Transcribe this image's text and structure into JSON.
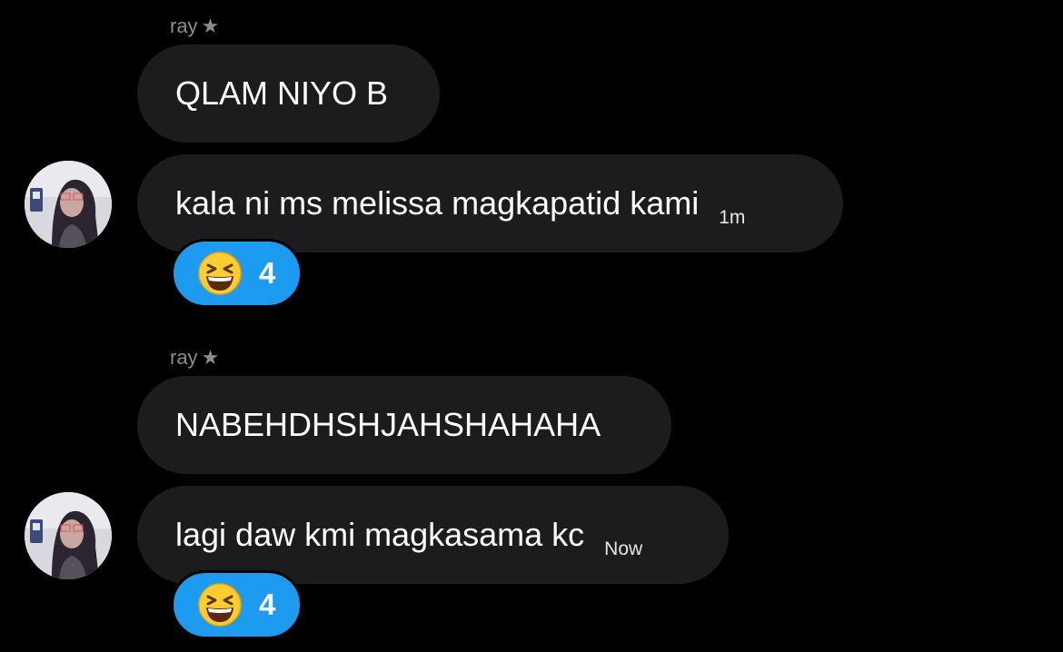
{
  "colors": {
    "background": "#000000",
    "bubble": "#1c1c1e",
    "reaction": "#1d9bf0",
    "sender_text": "#8b8b90"
  },
  "messages": [
    {
      "sender": "ray",
      "sender_badge_icon": "star-icon",
      "bubbles": [
        {
          "text": "QLAM NIYO B",
          "timestamp": ""
        },
        {
          "text": "kala ni ms melissa magkapatid kami",
          "timestamp": "1m",
          "reaction": {
            "icon": "grinning-squinting-face-emoji",
            "count": "4"
          }
        }
      ]
    },
    {
      "sender": "ray",
      "sender_badge_icon": "star-icon",
      "bubbles": [
        {
          "text": "NABEHDHSHJAHSHAHAHA",
          "timestamp": ""
        },
        {
          "text": "lagi daw kmi magkasama kc",
          "timestamp": "Now",
          "reaction": {
            "icon": "grinning-squinting-face-emoji",
            "count": "4"
          }
        }
      ]
    }
  ]
}
